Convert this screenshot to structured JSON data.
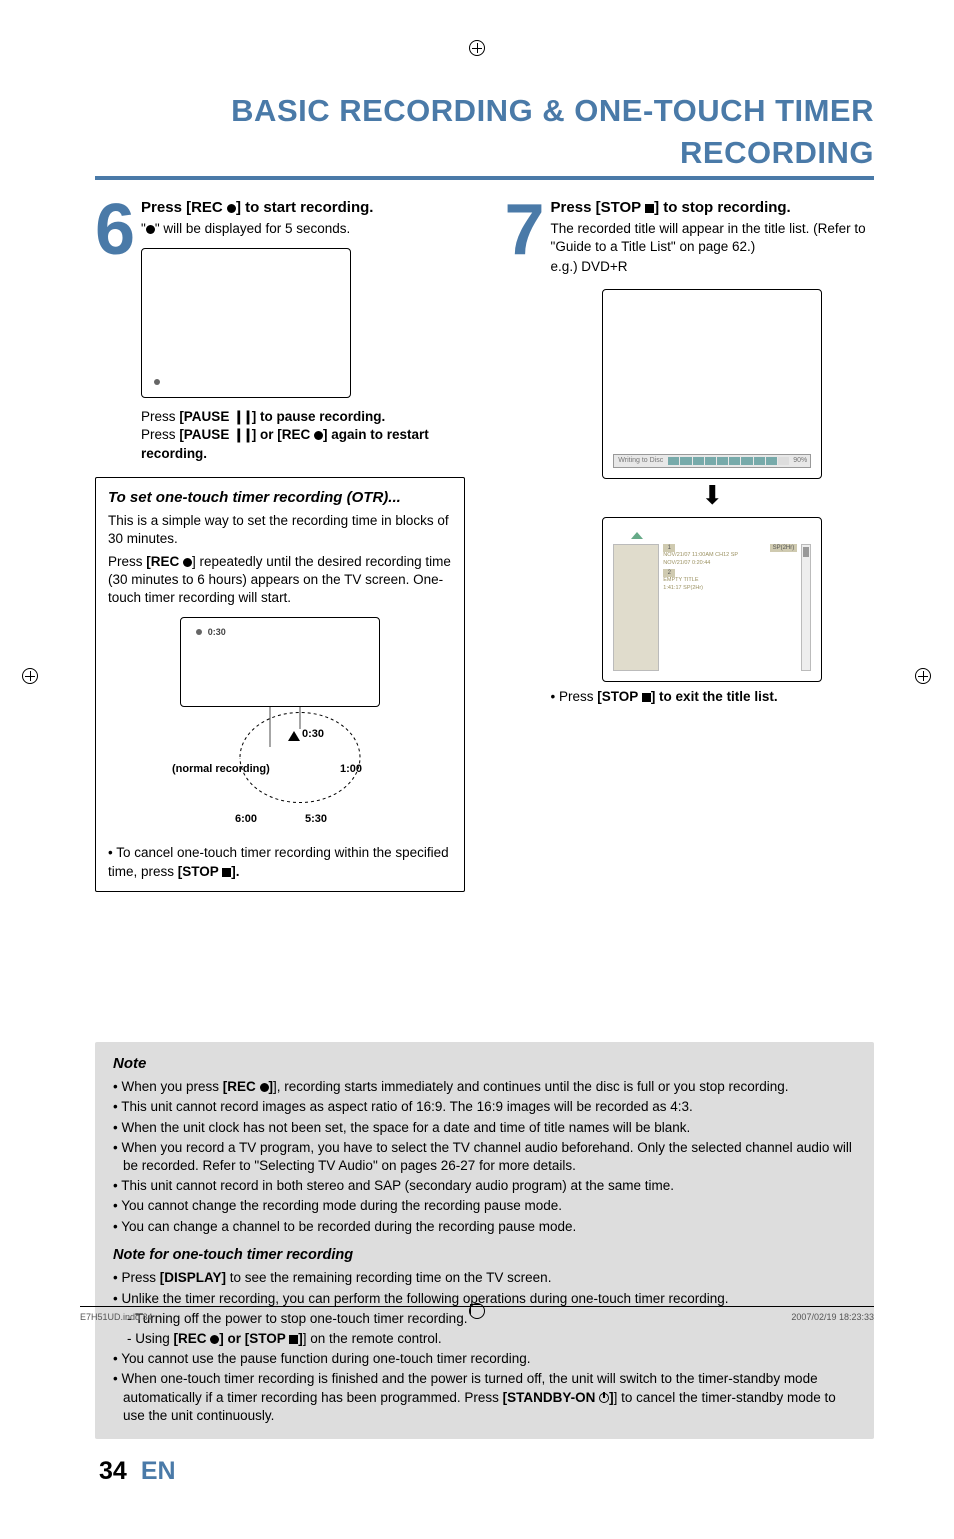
{
  "title": "BASIC RECORDING & ONE-TOUCH TIMER RECORDING",
  "step6": {
    "num": "6",
    "heading_pre": "Press ",
    "heading_btn": "[REC ",
    "heading_post": "] to start recording.",
    "sub_pre": "\"",
    "sub_post": "\" will be displayed for 5 seconds.",
    "pause_line_pre": "Press ",
    "pause_btn": "[PAUSE ",
    "pause_sym": "❙❙",
    "pause_line_post": "] to pause recording.",
    "restart_pre": "Press ",
    "restart_b1": "[PAUSE ",
    "restart_mid": "] or ",
    "restart_b2": "[REC ",
    "restart_post": "] again to restart recording."
  },
  "otr": {
    "heading": "To set one-touch timer recording (OTR)...",
    "p1": "This is a simple way to set the recording time in blocks of 30 minutes.",
    "p2_pre": "Press ",
    "p2_btn": "[REC ",
    "p2_post": "] repeatedly until the desired recording time (30 minutes to 6 hours) appears on the TV screen. One-touch timer recording will start.",
    "tv_label": "0:30",
    "circle": {
      "normal": "(normal recording)",
      "t030": "0:30",
      "t100": "1:00",
      "t530": "5:30",
      "t600": "6:00"
    },
    "cancel_pre": "• To cancel one-touch timer recording within the specified time, press ",
    "cancel_btn": "[STOP ",
    "cancel_post": "]."
  },
  "step7": {
    "num": "7",
    "heading_pre": "Press ",
    "heading_btn": "[STOP ",
    "heading_post": "] to stop recording.",
    "sub1": "The recorded title will appear in the title list. (Refer to \"Guide to a Title List\" on page 62.)",
    "sub2": "e.g.) DVD+R",
    "writing": "Writing to Disc",
    "pct": "90%",
    "entries": {
      "e1_num": "1",
      "e1_mode": "SP(2Hr)",
      "e1_l1": "NOV/21/07  11:00AM CH12 SP",
      "e1_l2": "NOV/21/07  0:20:44",
      "e2_num": "2",
      "e2_l1": "EMPTY TITLE",
      "e2_l2": "1:41:17   SP(2Hr)"
    },
    "exit_pre": "• Press ",
    "exit_btn": "[STOP ",
    "exit_post": "] to exit the title list."
  },
  "notes": {
    "heading": "Note",
    "items": [
      {
        "pre": "When you press ",
        "b": "[REC ",
        "icon": "rec",
        "post": "], recording starts immediately and continues until the disc is full or you stop recording."
      },
      {
        "text": "This unit cannot record images as aspect ratio of 16:9. The 16:9 images will be recorded as 4:3."
      },
      {
        "text": "When the unit clock has not been set, the space for a date and time of title names will be blank."
      },
      {
        "text": "When you record a TV program, you have to select the TV channel audio beforehand. Only the selected channel audio will be recorded. Refer to \"Selecting TV Audio\" on pages 26-27 for more details."
      },
      {
        "text": "This unit cannot record in both stereo and SAP (secondary audio program) at the same time."
      },
      {
        "text": "You cannot change the recording mode during the recording pause mode."
      },
      {
        "text": "You can change a channel to be recorded during the recording pause mode."
      }
    ],
    "heading2": "Note for one-touch timer recording",
    "items2": [
      {
        "pre": "Press ",
        "b": "[DISPLAY]",
        "post": " to see the remaining recording time on the TV screen."
      },
      {
        "text": "Unlike the timer recording, you can perform the following operations during one-touch timer recording."
      },
      {
        "sub": true,
        "text": "Turning off the power to stop one-touch timer recording."
      },
      {
        "sub": true,
        "pre": "Using ",
        "b": "[REC ",
        "icon": "rec",
        "mid": "] or ",
        "b2": "[STOP ",
        "icon2": "stop",
        "post": "] on the remote control."
      },
      {
        "text": "You cannot use the pause function during one-touch timer recording."
      },
      {
        "pre": "When one-touch timer recording is finished and the power is turned off, the unit will switch to the timer-standby mode automatically if a timer recording has been programmed. Press ",
        "b": "[STANDBY-ON ",
        "icon": "power",
        "post": "] to cancel the timer-standby mode to use the unit continuously."
      }
    ]
  },
  "footer": {
    "page": "34",
    "lang": "EN"
  },
  "printfooter": {
    "left": "E7H51UD.indd   34",
    "right": "2007/02/19   18:23:33"
  }
}
